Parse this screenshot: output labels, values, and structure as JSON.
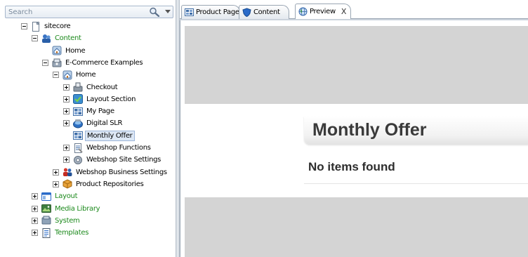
{
  "search": {
    "placeholder": "Search",
    "value": ""
  },
  "tree": [
    {
      "id": "sitecore",
      "label": "sitecore",
      "icon": "document-icon",
      "color": "black",
      "expander": "minus"
    },
    {
      "id": "content",
      "label": "Content",
      "icon": "content-icon",
      "color": "green",
      "expander": "minus"
    },
    {
      "id": "home-1",
      "label": "Home",
      "icon": "home-icon",
      "color": "black",
      "expander": "none"
    },
    {
      "id": "ecommerce-examples",
      "label": "E-Commerce Examples",
      "icon": "ecommerce-icon",
      "color": "black",
      "expander": "minus"
    },
    {
      "id": "home-2",
      "label": "Home",
      "icon": "home-icon",
      "color": "black",
      "expander": "minus"
    },
    {
      "id": "checkout",
      "label": "Checkout",
      "icon": "checkout-icon",
      "color": "black",
      "expander": "plus"
    },
    {
      "id": "layout-section",
      "label": "Layout Section",
      "icon": "layout-section-icon",
      "color": "black",
      "expander": "plus"
    },
    {
      "id": "my-page",
      "label": "My Page",
      "icon": "page-grid-icon",
      "color": "black",
      "expander": "plus"
    },
    {
      "id": "digital-slr",
      "label": "Digital SLR",
      "icon": "camera-icon",
      "color": "black",
      "expander": "plus"
    },
    {
      "id": "monthly-offer",
      "label": "Monthly Offer",
      "icon": "page-grid-icon",
      "color": "black",
      "expander": "none",
      "selected": true
    },
    {
      "id": "webshop-functions",
      "label": "Webshop Functions",
      "icon": "functions-icon",
      "color": "black",
      "expander": "plus"
    },
    {
      "id": "webshop-site-settings",
      "label": "Webshop Site Settings",
      "icon": "settings-icon",
      "color": "black",
      "expander": "plus"
    },
    {
      "id": "webshop-business-settings",
      "label": "Webshop Business Settings",
      "icon": "business-icon",
      "color": "black",
      "expander": "plus"
    },
    {
      "id": "product-repositories",
      "label": "Product Repositories",
      "icon": "repository-icon",
      "color": "black",
      "expander": "plus"
    },
    {
      "id": "layout",
      "label": "Layout",
      "icon": "layout-icon",
      "color": "green",
      "expander": "plus"
    },
    {
      "id": "media-library",
      "label": "Media Library",
      "icon": "media-icon",
      "color": "green",
      "expander": "plus"
    },
    {
      "id": "system",
      "label": "System",
      "icon": "system-icon",
      "color": "green",
      "expander": "plus"
    },
    {
      "id": "templates",
      "label": "Templates",
      "icon": "templates-icon",
      "color": "green",
      "expander": "plus"
    }
  ],
  "tabs": [
    {
      "label": "Product Page",
      "icon": "page-grid-icon",
      "active": false
    },
    {
      "label": "Content",
      "icon": "shield-icon",
      "active": false
    },
    {
      "label": "Preview",
      "icon": "globe-icon",
      "active": true,
      "close": "X"
    }
  ],
  "preview": {
    "title": "Monthly Offer",
    "message": "No items found"
  },
  "colors": {
    "green_label": "#1d8a1d",
    "selection_bg": "#dce7f5",
    "preview_gray": "#d4d4d4"
  }
}
